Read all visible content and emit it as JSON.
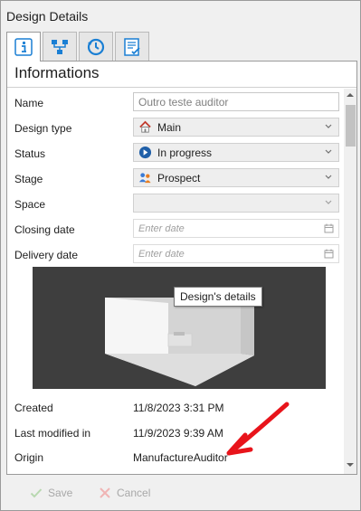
{
  "window": {
    "title": "Design Details"
  },
  "tabs": [
    {
      "icon": "info-icon",
      "active": true
    },
    {
      "icon": "hierarchy-icon",
      "active": false
    },
    {
      "icon": "history-icon",
      "active": false
    },
    {
      "icon": "checklist-icon",
      "active": false
    }
  ],
  "section": {
    "title": "Informations"
  },
  "fields": {
    "name": {
      "label": "Name",
      "value": "Outro teste auditor"
    },
    "design_type": {
      "label": "Design type",
      "value": "Main",
      "icon": "house-icon"
    },
    "status": {
      "label": "Status",
      "value": "In progress",
      "icon": "play-icon"
    },
    "stage": {
      "label": "Stage",
      "value": "Prospect",
      "icon": "people-icon"
    },
    "space": {
      "label": "Space",
      "value": ""
    },
    "closing_date": {
      "label": "Closing date",
      "placeholder": "Enter date"
    },
    "delivery_date": {
      "label": "Delivery date",
      "placeholder": "Enter date"
    }
  },
  "preview": {
    "tooltip": "Design's details"
  },
  "info": {
    "created": {
      "label": "Created",
      "value": "11/8/2023 3:31 PM"
    },
    "modified": {
      "label": "Last modified in",
      "value": "11/9/2023 9:39 AM"
    },
    "origin": {
      "label": "Origin",
      "value": "ManufactureAuditor"
    }
  },
  "buttons": {
    "save": "Save",
    "cancel": "Cancel"
  },
  "colors": {
    "accent": "#1a7fd4",
    "annotation": "#e8141b",
    "disabled": "#a8a8a8"
  }
}
